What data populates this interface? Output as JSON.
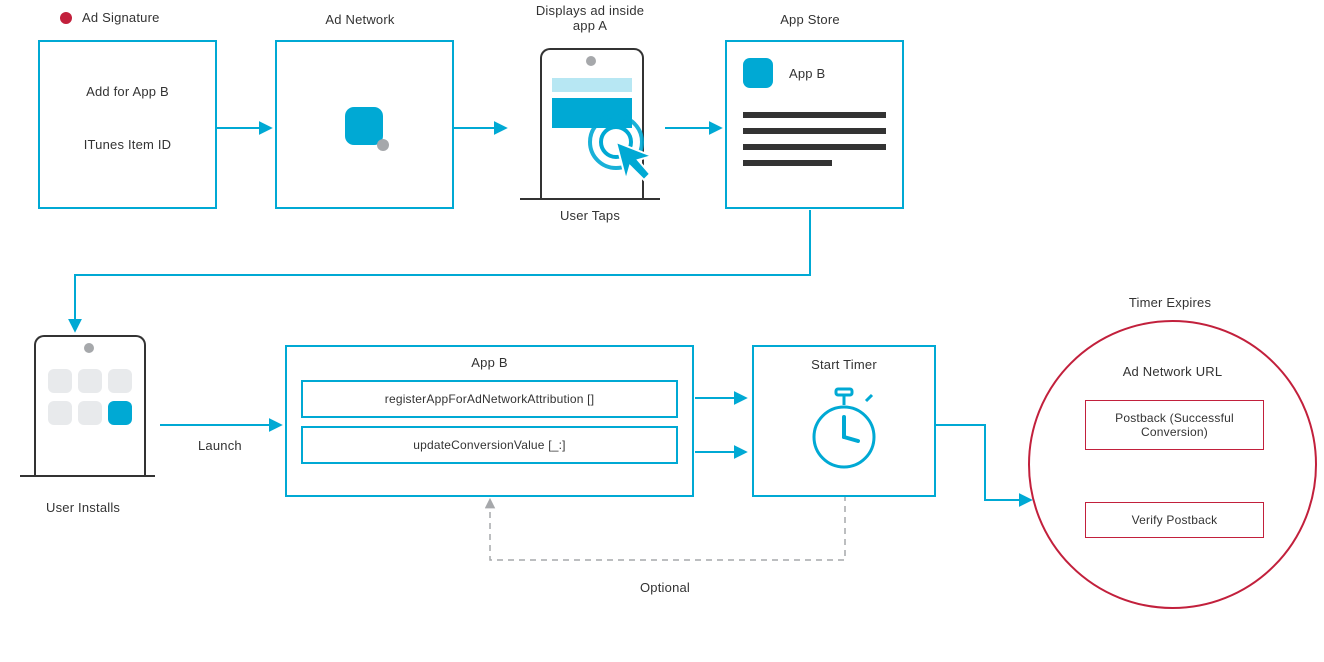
{
  "legend": {
    "ad_signature": "Ad Signature"
  },
  "row1": {
    "box1": {
      "line1": "Add for App B",
      "line2": "ITunes Item ID"
    },
    "box2_label": "Ad Network",
    "phone_top": "Displays ad inside\napp A",
    "phone_bottom": "User Taps",
    "appstore": {
      "title": "App Store",
      "app_label": "App B"
    }
  },
  "row2": {
    "installs_label": "User Installs",
    "launch_label": "Launch",
    "appB": {
      "title": "App B",
      "fn1": "registerAppForAdNetworkAttribution []",
      "fn2": "updateConversionValue [_:]"
    },
    "timer_label": "Start Timer",
    "optional_label": "Optional"
  },
  "circle": {
    "top_label": "Timer Expires",
    "inner_title": "Ad Network URL",
    "postback": "Postback\n(Successful Conversion)",
    "verify": "Verify Postback"
  }
}
